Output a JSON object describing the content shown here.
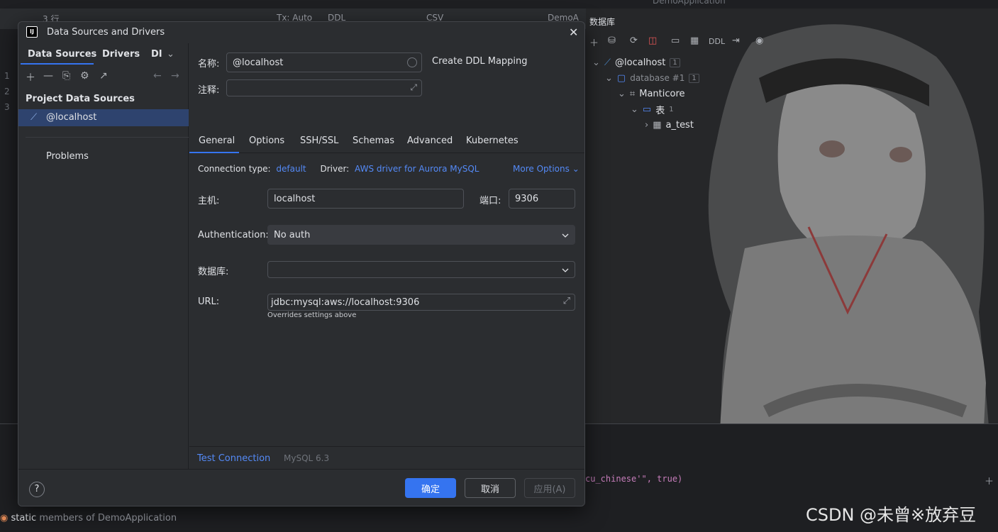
{
  "ide": {
    "toolbar": {
      "rows": "3 行",
      "tx": "Tx: Auto",
      "ddl": "DDL",
      "csv": "CSV",
      "demo": "DemoA",
      "top_app": "DemoApplication"
    },
    "line_numbers": [
      "1",
      "2",
      "3"
    ],
    "code_line": "cu_chinese'\", true)",
    "status_line_prefix": "static",
    "status_line": "members of DemoApplication",
    "watermark": "CSDN @未曾※放弃豆"
  },
  "db_panel": {
    "title": "数据库",
    "toolbar_ddl": "DDL",
    "tree": [
      {
        "label": "@localhost",
        "count": "1"
      },
      {
        "label": "database #1",
        "count": "1"
      },
      {
        "label": "Manticore",
        "count": ""
      },
      {
        "label": "表",
        "count": "1"
      },
      {
        "label": "a_test",
        "count": ""
      }
    ]
  },
  "dialog": {
    "title": "Data Sources and Drivers",
    "left_tabs": [
      "Data Sources",
      "Drivers",
      "DI"
    ],
    "section_header": "Project Data Sources",
    "data_source": "@localhost",
    "problems": "Problems",
    "name_label": "名称:",
    "name_value": "@localhost",
    "comment_label": "注释:",
    "comment_value": "",
    "create_ddl": "Create DDL Mapping",
    "tabs": [
      "General",
      "Options",
      "SSH/SSL",
      "Schemas",
      "Advanced",
      "Kubernetes"
    ],
    "connection_type_label": "Connection type:",
    "connection_type_value": "default",
    "driver_label": "Driver:",
    "driver_value": "AWS driver for Aurora MySQL",
    "more_options": "More Options",
    "host_label": "主机:",
    "host_value": "localhost",
    "port_label": "端口:",
    "port_value": "9306",
    "auth_label": "Authentication:",
    "auth_value": "No auth",
    "database_label": "数据库:",
    "database_value": "",
    "url_label": "URL:",
    "url_value": "jdbc:mysql:aws://localhost:9306",
    "url_hint": "Overrides settings above",
    "test_connection": "Test Connection",
    "driver_version": "MySQL 6.3",
    "help": "?",
    "ok": "确定",
    "cancel": "取消",
    "apply": "应用(A)"
  },
  "colors": {
    "accent": "#3574f0",
    "link": "#548af7",
    "selection": "#2e436e",
    "background": "#2b2d30"
  }
}
